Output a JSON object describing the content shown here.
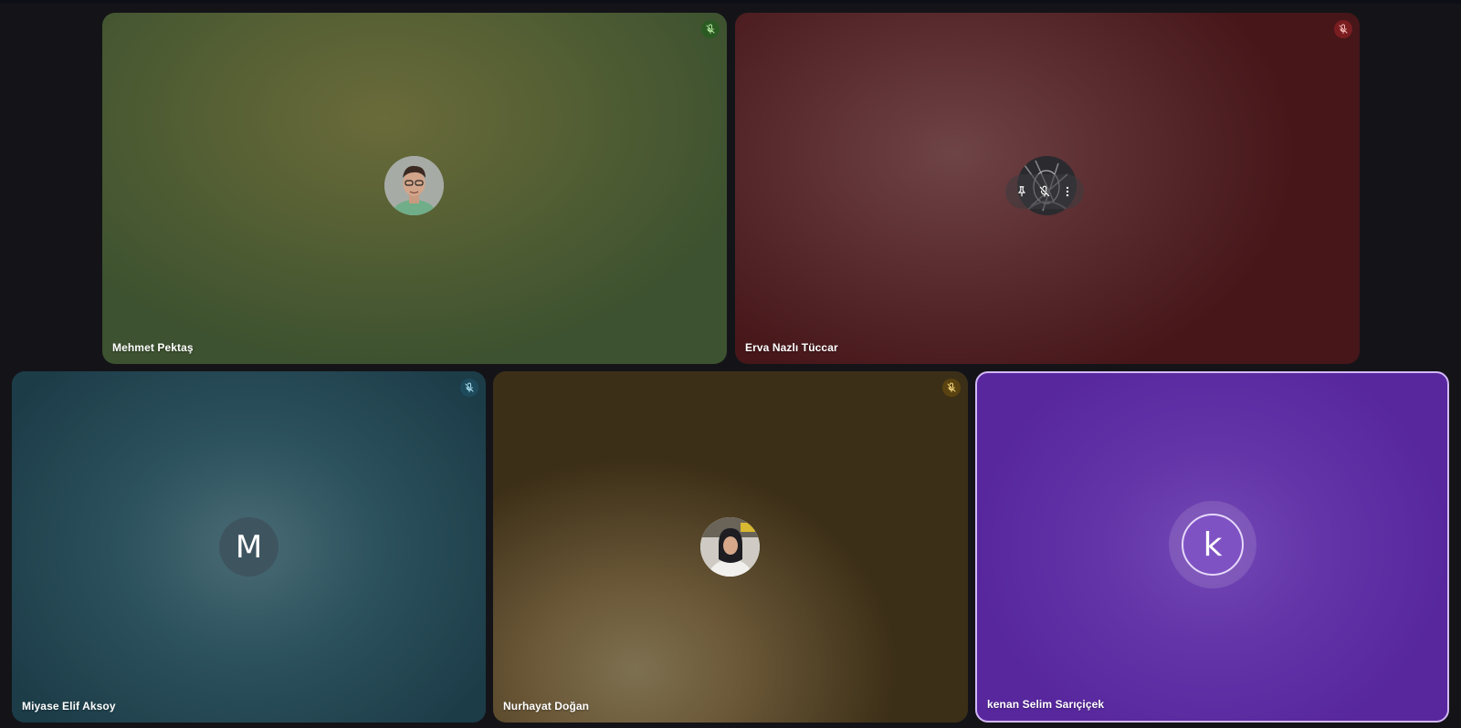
{
  "participants": [
    {
      "name": "Mehmet Pektaş",
      "muted": true,
      "mic_color": "#2c5a23",
      "avatar": "photo"
    },
    {
      "name": "Erva Nazlı Tüccar",
      "muted": true,
      "mic_color": "#7a1d20",
      "avatar": "photo",
      "hover_controls": [
        "pin-icon",
        "mic-off-icon",
        "more-vert-icon"
      ]
    },
    {
      "name": "Miyase Elif Aksoy",
      "muted": true,
      "mic_color": "#1e4b5c",
      "avatar_letter": "M"
    },
    {
      "name": "Nurhayat Doğan",
      "muted": true,
      "mic_color": "#5a4310",
      "avatar": "photo"
    },
    {
      "name": "kenan Selim Sarıçiçek",
      "muted": false,
      "active_speaker": true,
      "accent": "#d2b8f5",
      "avatar_letter": "k"
    }
  ]
}
